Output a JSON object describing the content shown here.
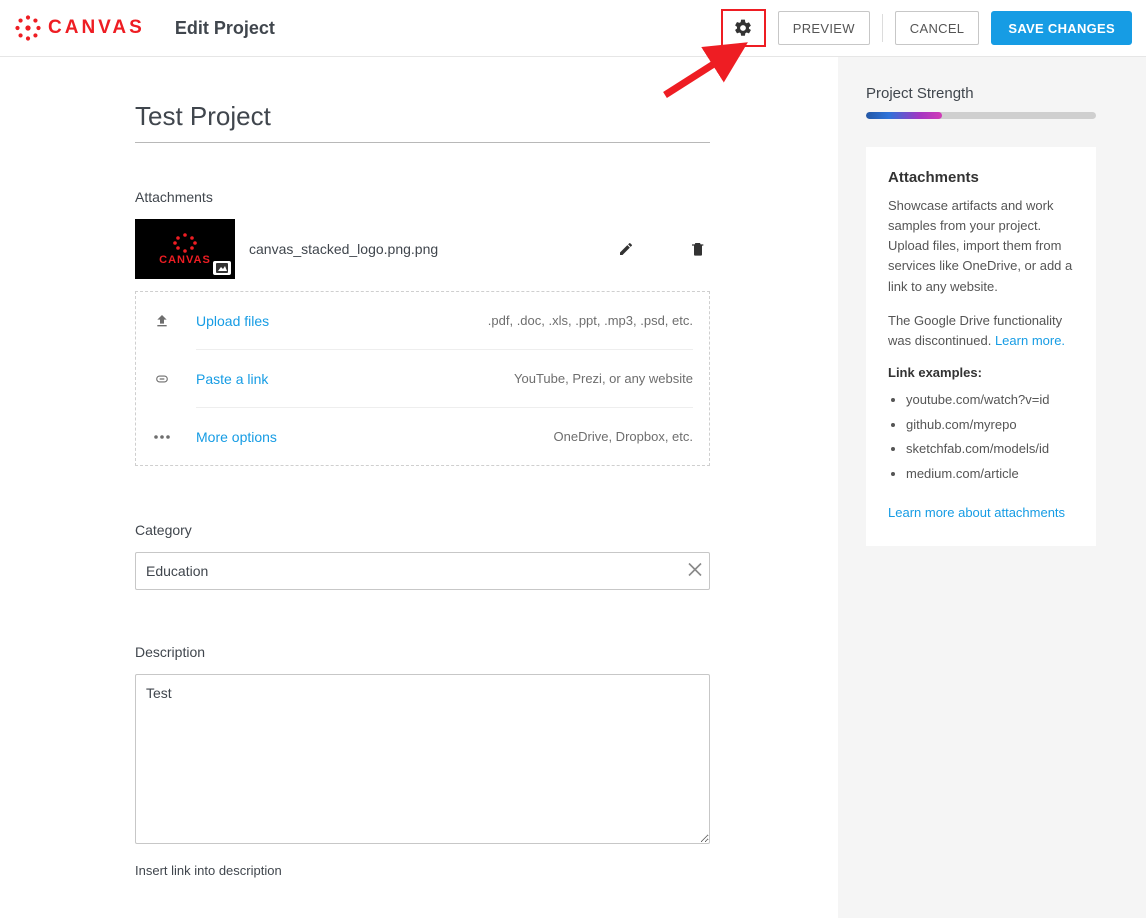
{
  "header": {
    "brand": "CANVAS",
    "page_title": "Edit Project",
    "preview_label": "PREVIEW",
    "cancel_label": "CANCEL",
    "save_label": "SAVE CHANGES"
  },
  "project": {
    "title": "Test Project"
  },
  "attachments": {
    "heading": "Attachments",
    "items": [
      {
        "filename": "canvas_stacked_logo.png.png"
      }
    ],
    "upload": {
      "upload_label": "Upload files",
      "upload_hint": ".pdf, .doc, .xls, .ppt, .mp3, .psd, etc.",
      "paste_label": "Paste a link",
      "paste_hint": "YouTube, Prezi, or any website",
      "more_label": "More options",
      "more_hint": "OneDrive, Dropbox, etc."
    }
  },
  "category": {
    "heading": "Category",
    "value": "Education"
  },
  "description": {
    "heading": "Description",
    "value": "Test",
    "insert_link_label": "Insert link into description"
  },
  "sidebar": {
    "strength_heading": "Project Strength",
    "strength_percent": 33,
    "card": {
      "title": "Attachments",
      "body1": "Showcase artifacts and work samples from your project. Upload files, import them from services like OneDrive, or add a link to any website.",
      "body2_prefix": "The Google Drive functionality was discontinued. ",
      "body2_link": "Learn more.",
      "examples_heading": "Link examples:",
      "examples": [
        "youtube.com/watch?v=id",
        "github.com/myrepo",
        "sketchfab.com/models/id",
        "medium.com/article"
      ],
      "learn_more": "Learn more about attachments"
    }
  }
}
